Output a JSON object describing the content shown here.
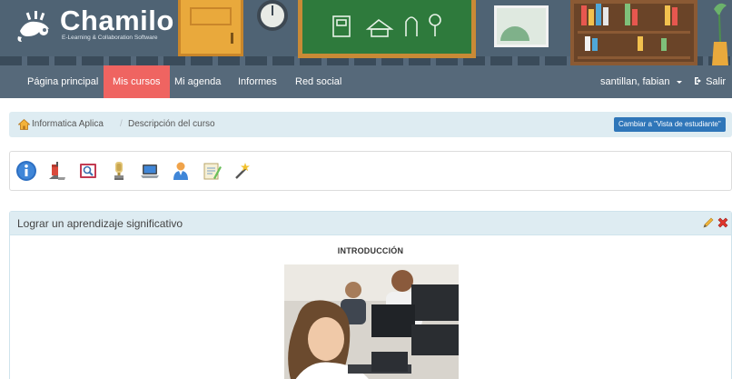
{
  "branding": {
    "logo_name": "Chamilo",
    "logo_tagline": "E-Learning & Collaboration Software"
  },
  "navbar": {
    "items": [
      {
        "label": "Página principal",
        "active": false
      },
      {
        "label": "Mis cursos",
        "active": true
      },
      {
        "label": "Mi agenda",
        "active": false
      },
      {
        "label": "Informes",
        "active": false
      },
      {
        "label": "Red social",
        "active": false
      }
    ],
    "user_label": "santillan, fabian",
    "logout_icon": "logout-icon",
    "logout_label": "Salir"
  },
  "breadcrumb": {
    "home_icon": "home-icon",
    "items": [
      "Informatica Aplica",
      "Descripción del curso"
    ],
    "separator": "/",
    "switch_view_label": "Cambiar a \"Vista de estudiante\""
  },
  "toolbar": {
    "icons": [
      "info-icon",
      "prerequisites-icon",
      "book-icon",
      "trophy-icon",
      "laptop-icon",
      "person-icon",
      "notepad-icon",
      "magic-wand-icon"
    ]
  },
  "panel": {
    "title": "Lograr un aprendizaje significativo",
    "heading": "INTRODUCCIÓN",
    "actions": [
      "edit-icon",
      "delete-icon"
    ]
  },
  "colors": {
    "navbar_bg": "#56697a",
    "active_tab": "#ef6461",
    "breadcrumb_bg": "#deecf2",
    "primary_button": "#2f76b9"
  }
}
